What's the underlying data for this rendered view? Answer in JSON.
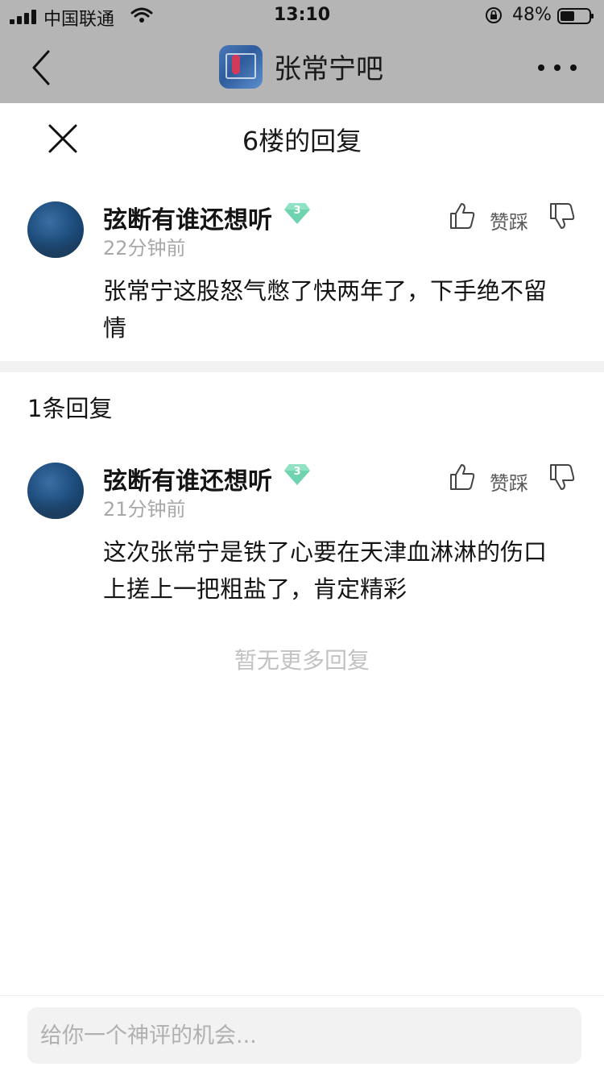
{
  "status_bar": {
    "carrier": "中国联通",
    "time": "13:10",
    "battery": "48%"
  },
  "forum": {
    "name": "张常宁吧"
  },
  "sheet": {
    "title": "6楼的回复"
  },
  "main_comment": {
    "username": "弦断有谁还想听",
    "level": "3",
    "time": "22分钟前",
    "vote_label": "赞踩",
    "text": "张常宁这股怒气憋了快两年了，下手绝不留情"
  },
  "replies_header": "1条回复",
  "replies": [
    {
      "username": "弦断有谁还想听",
      "level": "3",
      "time": "21分钟前",
      "vote_label": "赞踩",
      "text": "这次张常宁是铁了心要在天津血淋淋的伤口上搓上一把粗盐了，肯定精彩"
    }
  ],
  "no_more_text": "暂无更多回复",
  "input": {
    "placeholder": "给你一个神评的机会..."
  },
  "colors": {
    "badge": "#6fd3b0",
    "top_bar": "#b5b5b5"
  }
}
